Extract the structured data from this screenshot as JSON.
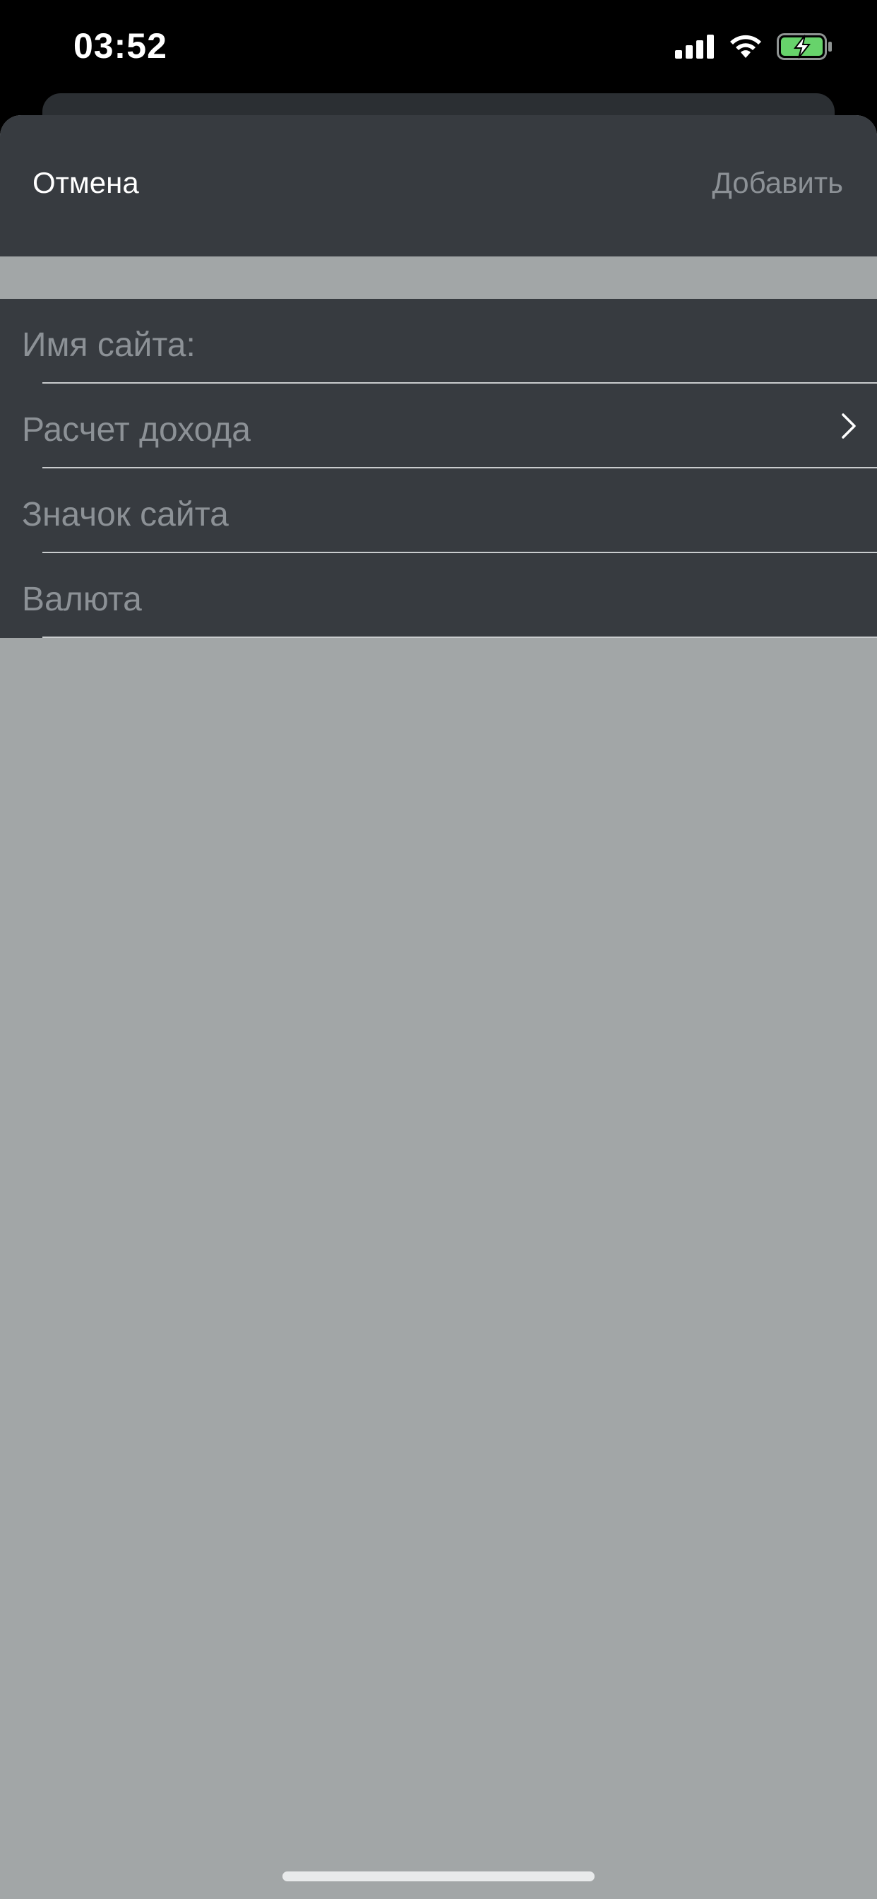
{
  "status_bar": {
    "time": "03:52",
    "icons": [
      "signal-icon",
      "wifi-icon",
      "battery-charging-icon"
    ],
    "battery_color": "#67d36b"
  },
  "nav": {
    "cancel_label": "Отмена",
    "add_label": "Добавить"
  },
  "form": {
    "rows": [
      {
        "label": "Имя сайта:",
        "has_chevron": false
      },
      {
        "label": "Расчет дохода",
        "has_chevron": true
      },
      {
        "label": "Значок сайта",
        "has_chevron": false
      },
      {
        "label": "Валюта",
        "has_chevron": false
      }
    ]
  },
  "colors": {
    "sheet_background": "#a2a6a7",
    "row_background": "#373b40",
    "placeholder_text": "#8c9196",
    "accent_text": "#ffffff"
  }
}
